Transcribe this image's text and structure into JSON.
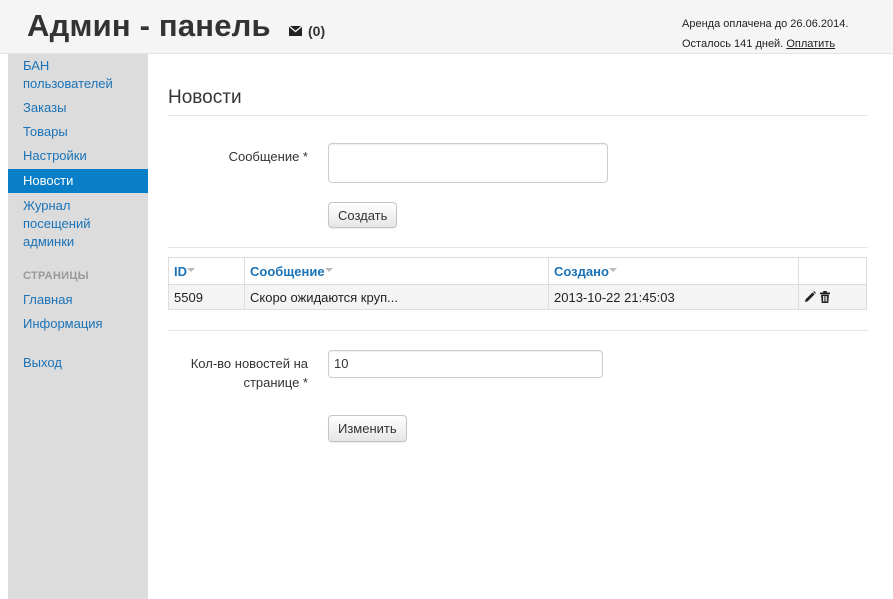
{
  "header": {
    "brand": "Админ - панель",
    "messages_count": "(0)",
    "rent_paid_until": "Аренда оплачена до 26.06.2014.",
    "days_left": "Осталось 141 дней.",
    "pay_link": "Оплатить"
  },
  "sidebar": {
    "items": [
      {
        "label": "БАН пользователей"
      },
      {
        "label": "Заказы"
      },
      {
        "label": "Товары"
      },
      {
        "label": "Настройки"
      },
      {
        "label": "Новости",
        "active": true
      },
      {
        "label": "Журнал посещений админки"
      }
    ],
    "section_header": "СТРАНИЦЫ",
    "pages": [
      {
        "label": "Главная"
      },
      {
        "label": "Информация"
      }
    ],
    "logout": "Выход"
  },
  "main": {
    "title": "Новости",
    "message_label": "Сообщение *",
    "create_button": "Создать",
    "table": {
      "columns": [
        "ID",
        "Сообщение",
        "Создано"
      ],
      "rows": [
        {
          "id": "5509",
          "message": "Скоро ожидаются круп...",
          "created": "2013-10-22 21:45:03"
        }
      ]
    },
    "per_page_label_line1": "Кол-во новостей на",
    "per_page_label_line2": "странице *",
    "per_page_value": "10",
    "update_button": "Изменить"
  },
  "colors": {
    "link": "#1a73b8",
    "active_nav": "#0a7fc8",
    "sidebar_bg": "#dcdcdc",
    "header_bg": "#f5f5f5"
  },
  "icons": {
    "messages": "envelope-icon",
    "edit": "pencil-icon",
    "delete": "trash-icon"
  }
}
